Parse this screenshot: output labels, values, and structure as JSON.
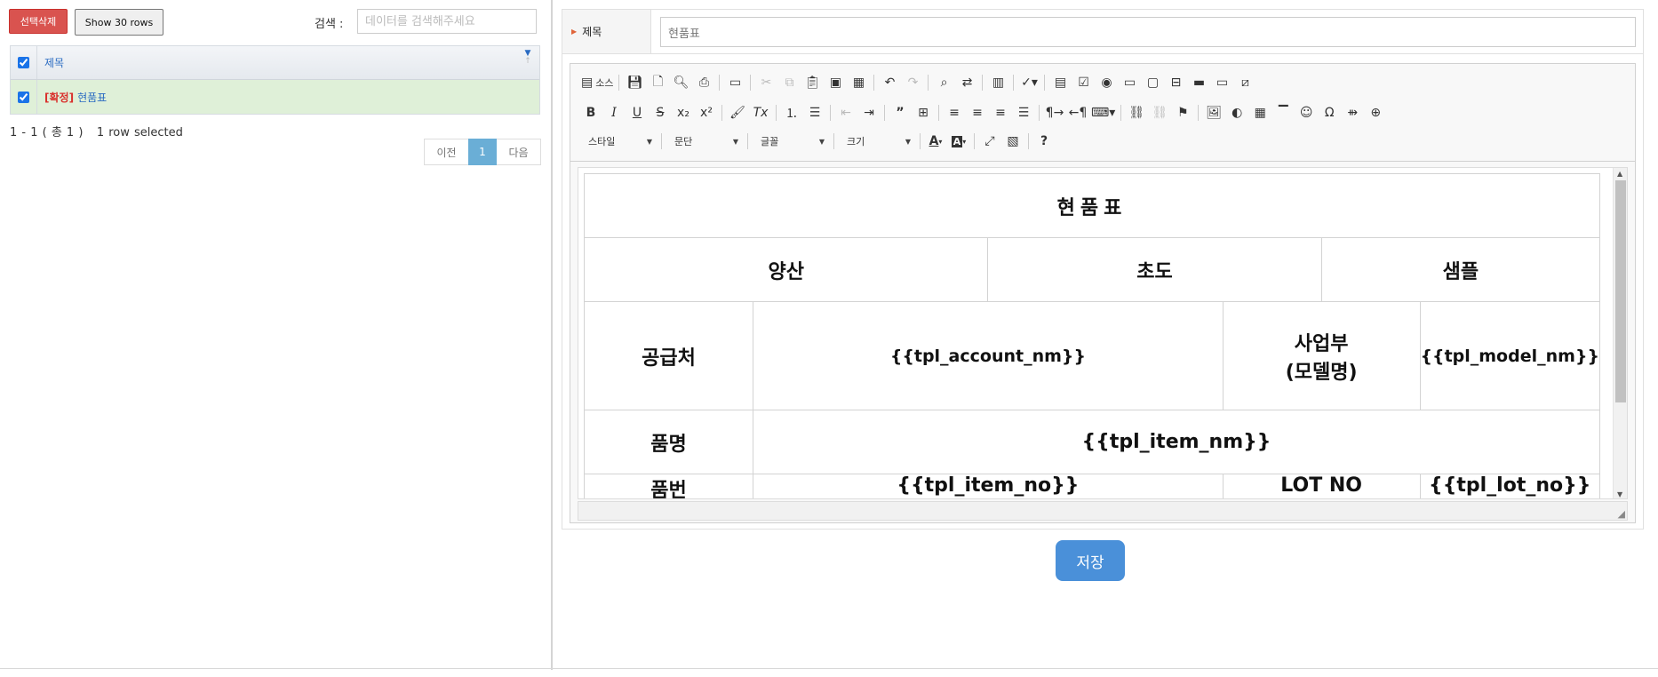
{
  "list_panel": {
    "delete_button": "선택삭제",
    "rows_button": "Show 30 rows",
    "search_label": "검색 :",
    "search_placeholder": "데이터를 검색해주세요",
    "column_title": "제목",
    "rows": [
      {
        "tag": "[확정]",
        "title": "현품표",
        "selected": true
      }
    ],
    "pager_info": "1 - 1 ( 총 1 )",
    "selected_info": "1 row selected",
    "prev_label": "이전",
    "current_page": "1",
    "next_label": "다음"
  },
  "form": {
    "title_label": "제목",
    "title_value": "현품표",
    "save_button": "저장"
  },
  "editor_toolbar": {
    "source_label": "소스",
    "combos": [
      "스타일",
      "문단",
      "글꼴",
      "크기"
    ],
    "row1_icons": [
      "source-icon",
      "save-icon",
      "new-page-icon",
      "preview-icon",
      "print-icon",
      "templates-icon",
      "cut-icon",
      "copy-icon",
      "paste-icon",
      "paste-text-icon",
      "paste-word-icon",
      "undo-icon",
      "redo-icon",
      "find-icon",
      "replace-icon",
      "select-all-icon",
      "spellcheck-icon",
      "form-icon",
      "checkbox-icon",
      "radio-icon",
      "textfield-icon",
      "textarea-icon",
      "select-icon",
      "button-icon",
      "image-button-icon",
      "hidden-field-icon"
    ],
    "row2_icons": [
      "bold-icon",
      "italic-icon",
      "underline-icon",
      "strike-icon",
      "subscript-icon",
      "superscript-icon",
      "copy-format-icon",
      "remove-format-icon",
      "numbered-list-icon",
      "bulleted-list-icon",
      "outdent-icon",
      "indent-icon",
      "blockquote-icon",
      "div-icon",
      "align-left-icon",
      "align-center-icon",
      "align-right-icon",
      "justify-icon",
      "ltr-icon",
      "rtl-icon",
      "language-icon",
      "link-icon",
      "unlink-icon",
      "anchor-icon",
      "image-icon",
      "flash-icon",
      "table-icon",
      "horizontal-rule-icon",
      "smiley-icon",
      "special-char-icon",
      "page-break-icon",
      "iframe-icon"
    ],
    "row3_icons": [
      "text-color-icon",
      "bg-color-icon",
      "maximize-icon",
      "show-blocks-icon",
      "help-icon"
    ]
  },
  "document": {
    "heading": "현품표",
    "type_headers": [
      "양산",
      "초도",
      "샘플"
    ],
    "supplier_label": "공급처",
    "account_tpl": "{{tpl_account_nm}}",
    "division_label_line1": "사업부",
    "division_label_line2": "(모델명)",
    "model_tpl": "{{tpl_model_nm}}",
    "item_label": "품명",
    "item_tpl": "{{tpl_item_nm}}",
    "row5_label": "품번",
    "row5_tpl": "{{tpl_item_no}}",
    "row5_label2": "LOT NO",
    "row5_tpl2": "{{tpl_lot_no}}"
  }
}
